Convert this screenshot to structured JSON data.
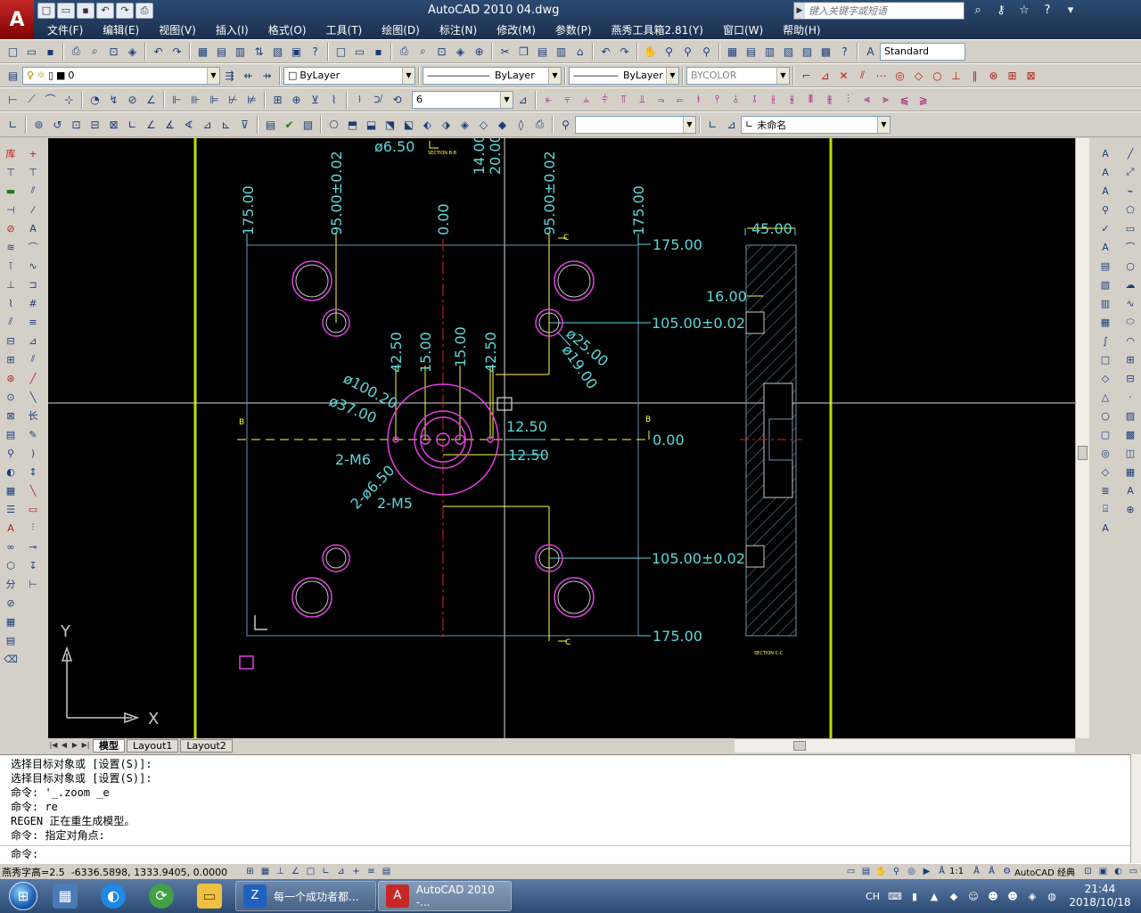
{
  "window": {
    "app_logo": "A",
    "title": "AutoCAD 2010    04.dwg",
    "search_placeholder": "键入关键字或短语",
    "menus": [
      "文件(F)",
      "编辑(E)",
      "视图(V)",
      "插入(I)",
      "格式(O)",
      "工具(T)",
      "绘图(D)",
      "标注(N)",
      "修改(M)",
      "参数(P)",
      "燕秀工具箱2.81(Y)",
      "窗口(W)",
      "帮助(H)"
    ]
  },
  "toolbars": {
    "style_combo": "Standard",
    "layer_combo": "0",
    "color_combo": "ByLayer",
    "linetype_combo": "ByLayer",
    "lineweight_combo": "ByLayer",
    "plotstyle_combo": "BYCOLOR",
    "dim_combo": "6",
    "ucs_combo": "未命名"
  },
  "drawing": {
    "colors": {
      "cyan": "#5fd6d6",
      "magenta": "#e040e0",
      "red": "#e02020",
      "yellow": "#ffff40",
      "green": "#b8e000",
      "white": "#c8c8c8"
    },
    "dims": {
      "d650": "ø6.50",
      "v1400": "14.00",
      "v2000": "20.00",
      "v175l": "175.00",
      "v95l": "95.00±0.02",
      "v000": "0.00",
      "v95r": "95.00±0.02",
      "v175r": "175.00",
      "h175t": "175.00",
      "h45": "45.00",
      "h16": "16.00",
      "h105t": "105.00±0.02",
      "d25": "ø25.00",
      "d19": "ø19.00",
      "v425a": "42.50",
      "v15a": "15.00",
      "v15b": "15.00",
      "v425b": "42.50",
      "d100": "ø100.20",
      "d37": "ø37.00",
      "h1250a": "12.50",
      "h1250b": "12.50",
      "h000": "0.00",
      "m6": "2-M6",
      "d650b": "2-ø6.50",
      "m5": "2-M5",
      "h105b": "105.00±0.02",
      "h175b": "175.00",
      "secB": "SECTION B-B",
      "secC": "SECTION C-C",
      "markB1": "B",
      "markB2": "B",
      "markC1": "C",
      "markC2": "C",
      "ucsX": "X",
      "ucsY": "Y"
    }
  },
  "layout_tabs": [
    "模型",
    "Layout1",
    "Layout2"
  ],
  "command_history": [
    "选择目标对象或 [设置(S)]:",
    "选择目标对象或 [设置(S)]:",
    "命令: '_.zoom _e",
    "命令: re",
    "REGEN 正在重生成模型。",
    "命令: 指定对角点:"
  ],
  "command_prompt": "命令:",
  "status": {
    "coords": "燕秀字高=2.5  -6336.5898, 1333.9405, 0.0000",
    "annotation_scale": "1:1",
    "workspace": "AutoCAD 经典"
  },
  "taskbar": {
    "tasks": [
      "每一个成功者都...",
      "AutoCAD 2010 -..."
    ],
    "ime": "CH",
    "time": "21:44",
    "date": "2018/10/18"
  }
}
